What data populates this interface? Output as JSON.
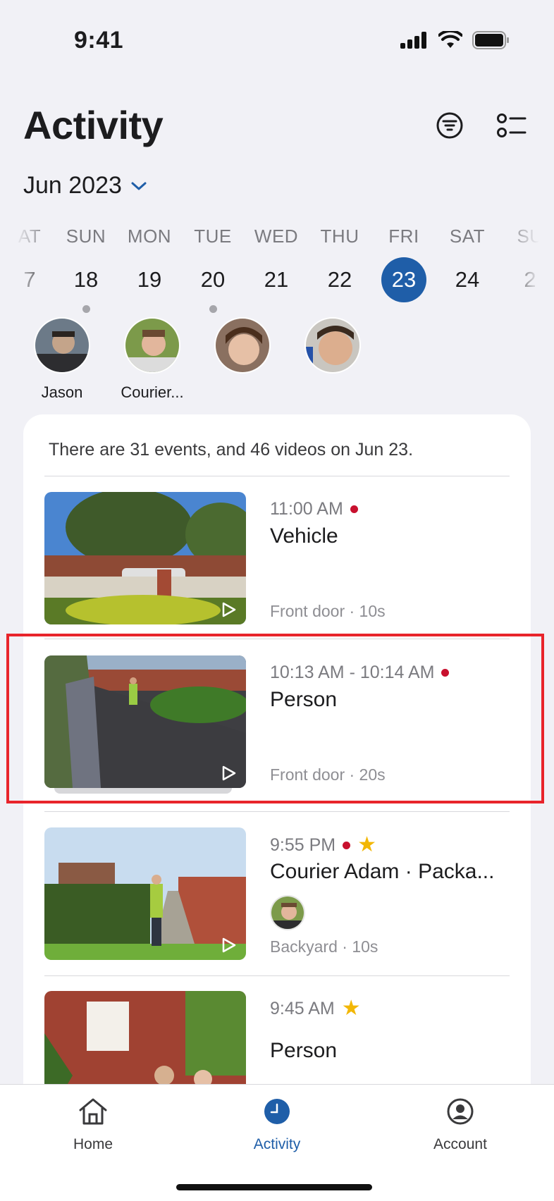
{
  "status": {
    "time": "9:41"
  },
  "header": {
    "title": "Activity",
    "month": "Jun 2023"
  },
  "days": [
    {
      "name": "AT",
      "num": "7",
      "dot": false,
      "selected": false
    },
    {
      "name": "SUN",
      "num": "18",
      "dot": true,
      "selected": false
    },
    {
      "name": "MON",
      "num": "19",
      "dot": false,
      "selected": false
    },
    {
      "name": "TUE",
      "num": "20",
      "dot": true,
      "selected": false
    },
    {
      "name": "WED",
      "num": "21",
      "dot": false,
      "selected": false
    },
    {
      "name": "THU",
      "num": "22",
      "dot": false,
      "selected": false
    },
    {
      "name": "FRI",
      "num": "23",
      "dot": false,
      "selected": true
    },
    {
      "name": "SAT",
      "num": "24",
      "dot": false,
      "selected": false
    },
    {
      "name": "SU",
      "num": "2",
      "dot": false,
      "selected": false
    }
  ],
  "faces": [
    {
      "name": "Jason"
    },
    {
      "name": "Courier..."
    },
    {
      "name": ""
    },
    {
      "name": ""
    }
  ],
  "summary": "There are 31 events, and 46 videos on Jun 23.",
  "events": [
    {
      "time": "11:00 AM",
      "title": "Vehicle",
      "meta": "Front door · 10s",
      "recorded": true,
      "starred": false
    },
    {
      "time": "10:13 AM - 10:14 AM",
      "title": "Person",
      "meta": "Front door · 20s",
      "recorded": true,
      "starred": false
    },
    {
      "time": "9:55 PM",
      "title": "Courier Adam  · Packa...",
      "meta": "Backyard · 10s",
      "recorded": true,
      "starred": true
    },
    {
      "time": "9:45 AM",
      "title": "Person",
      "meta": "",
      "recorded": false,
      "starred": true
    }
  ],
  "tabs": [
    {
      "label": "Home"
    },
    {
      "label": "Activity"
    },
    {
      "label": "Account"
    }
  ],
  "colors": {
    "accent": "#1f5ea8",
    "record": "#c8102e",
    "star": "#f2b705",
    "highlight": "#e8242b"
  }
}
